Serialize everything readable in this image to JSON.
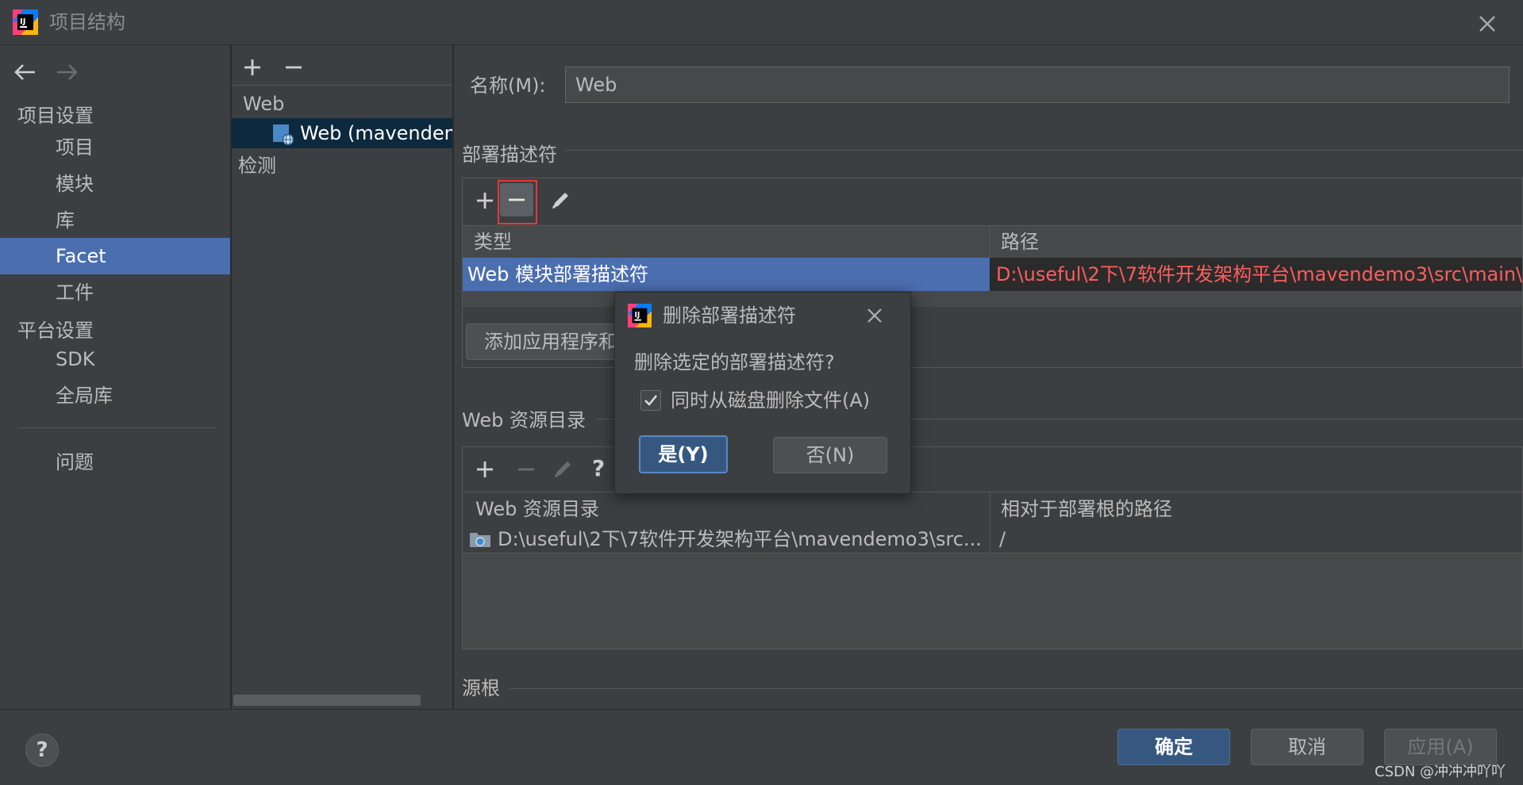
{
  "window": {
    "title": "项目结构"
  },
  "nav": {
    "sections": [
      {
        "heading": "项目设置",
        "items": [
          "项目",
          "模块",
          "库",
          "Facet",
          "工件"
        ]
      },
      {
        "heading": "平台设置",
        "items": [
          "SDK",
          "全局库"
        ]
      }
    ],
    "problems": "问题",
    "selected": "Facet"
  },
  "tree": {
    "group": "Web",
    "item": "Web (mavendem",
    "detection": "检测"
  },
  "form": {
    "name_label": "名称(M):",
    "name_value": "Web"
  },
  "descriptors": {
    "section_title": "部署描述符",
    "columns": [
      "类型",
      "路径"
    ],
    "rows": [
      {
        "type": "Web 模块部署描述符",
        "path": "D:\\useful\\2下\\7软件开发架构平台\\mavendemo3\\src\\main\\"
      }
    ],
    "add_button": "添加应用程序和",
    "path_color": "#ff5d5d"
  },
  "web_resources": {
    "section_title": "Web 资源目录",
    "columns": [
      "Web 资源目录",
      "相对于部署根的路径"
    ],
    "rows": [
      {
        "dir": "D:\\useful\\2下\\7软件开发架构平台\\mavendemo3\\src...",
        "relative": "/"
      }
    ]
  },
  "source_roots": {
    "section_title": "源根"
  },
  "dialog": {
    "title": "删除部署描述符",
    "message": "删除选定的部署描述符?",
    "checkbox_label": "同时从磁盘删除文件(A)",
    "checkbox_checked": true,
    "yes": "是(Y)",
    "no": "否(N)"
  },
  "footer": {
    "ok": "确定",
    "cancel": "取消",
    "apply": "应用(A)",
    "watermark": "CSDN @冲冲冲吖吖"
  },
  "colors": {
    "accent": "#4b6eaf",
    "highlight_box": "#e53935"
  }
}
